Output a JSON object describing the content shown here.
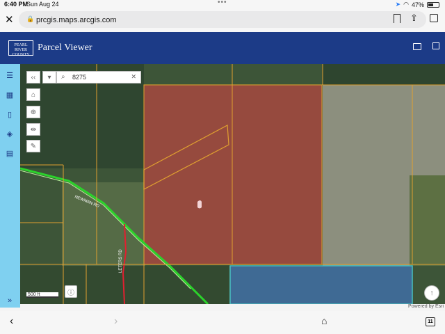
{
  "status": {
    "time": "6:40 PM",
    "date": "Sun Aug 24",
    "battery": "47%",
    "battery_level": 0.47
  },
  "browser": {
    "url": "prcgis.maps.arcgis.com"
  },
  "app": {
    "title": "Parcel Viewer",
    "logo_text": "PEARL RIVER COUNTY"
  },
  "search": {
    "value": "8275"
  },
  "map": {
    "scale_label": "500 ft",
    "road_labels": [
      "NEWMAN RD",
      "LETERS RD"
    ],
    "attribution": "Powered by Esri",
    "colors": {
      "selected_parcel": "#a0493f",
      "water": "#3f6a94",
      "parcel_line": "#e0a030",
      "road_green": "#2bd32b",
      "road_red": "#e02030"
    }
  },
  "tabs": {
    "count": "11"
  }
}
